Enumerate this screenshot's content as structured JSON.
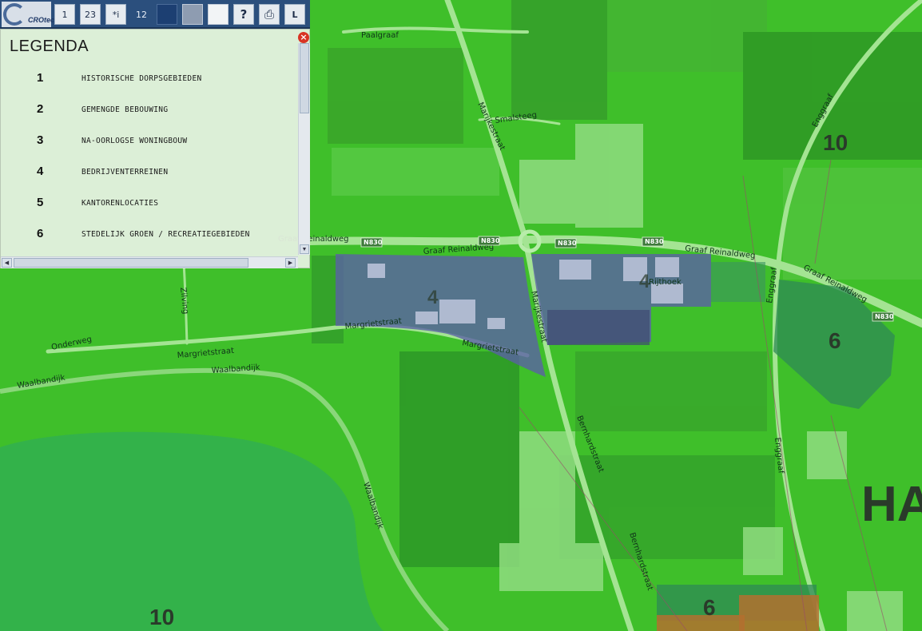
{
  "toolbar": {
    "logo_text": "CROtec",
    "buttons": [
      {
        "name": "layers-button",
        "icon": "layers-icon",
        "glyph": "1"
      },
      {
        "name": "home-button",
        "icon": "home-icon",
        "glyph": "23"
      },
      {
        "name": "info-button",
        "icon": "info-icon",
        "glyph": "*i"
      },
      {
        "name": "measure-button",
        "icon": "measure-icon",
        "glyph": "12"
      },
      {
        "name": "dark-layer-button",
        "icon": "square-icon",
        "glyph": ""
      },
      {
        "name": "grey-layer-button",
        "icon": "square-icon",
        "glyph": ""
      },
      {
        "name": "white-layer-button",
        "icon": "square-icon",
        "glyph": ""
      },
      {
        "name": "help-button",
        "icon": "help-icon",
        "glyph": "?"
      },
      {
        "name": "print-button",
        "icon": "print-icon",
        "glyph": "⎙"
      },
      {
        "name": "legend-button",
        "icon": "legend-icon",
        "glyph": "L"
      }
    ]
  },
  "legend": {
    "title": "LEGENDA",
    "items": [
      {
        "num": "1",
        "label": "HISTORISCHE DORPSGEBIEDEN"
      },
      {
        "num": "2",
        "label": "GEMENGDE BEBOUWING"
      },
      {
        "num": "3",
        "label": "NA-OORLOGSE WONINGBOUW"
      },
      {
        "num": "4",
        "label": "BEDRIJVENTERREINEN"
      },
      {
        "num": "5",
        "label": "KANTORENLOCATIES"
      },
      {
        "num": "6",
        "label": "STEDELIJK GROEN / RECREATIEGEBIEDEN"
      }
    ]
  },
  "map": {
    "streets": {
      "paalgraaf": "Paalgraaf",
      "smalsteeg": "Smalsteeg",
      "marijkestraat_top": "Marijkestraat",
      "marijkestraat_mid": "Marijkestraat",
      "graaf_reinaldweg_1": "Graaf Reinaldweg",
      "graaf_reinaldweg_2": "Graaf Reinaldweg",
      "graaf_reinaldweg_3": "Graaf Reinaldweg",
      "graaf_reinaldweg_4": "Graaf Reinaldweg",
      "margrietstraat_1": "Margrietstraat",
      "margrietstraat_2": "Margrietstraat",
      "onderweg": "Onderweg",
      "waalbandijk_1": "Waalbandijk",
      "waalbandijk_2": "Waalbandijk",
      "waalbandijk_3": "Waalbandijk",
      "bernhardstraat_1": "Bernhardstraat",
      "bernhardstraat_2": "Bernhardstraat",
      "enggraaf_1": "Enggraaf",
      "enggraaf_2": "Enggraaf",
      "enggraaf_3": "Enggraaf",
      "zilving": "Zilving",
      "rijthoek": "Rijthoek"
    },
    "route_shields": [
      "N830",
      "N830",
      "N830",
      "N830",
      "N830"
    ],
    "zones": {
      "z10_top": "10",
      "z10_bottom": "10",
      "z6_right": "6",
      "z6_bottom": "6",
      "z4_left": "4",
      "z4_right": "4",
      "place": "HA"
    },
    "colors": {
      "green_overlay": "#3fbf2a",
      "industrial": "#5b5fa8",
      "recreation": "#2f8a55",
      "orange": "#b3702f"
    }
  }
}
